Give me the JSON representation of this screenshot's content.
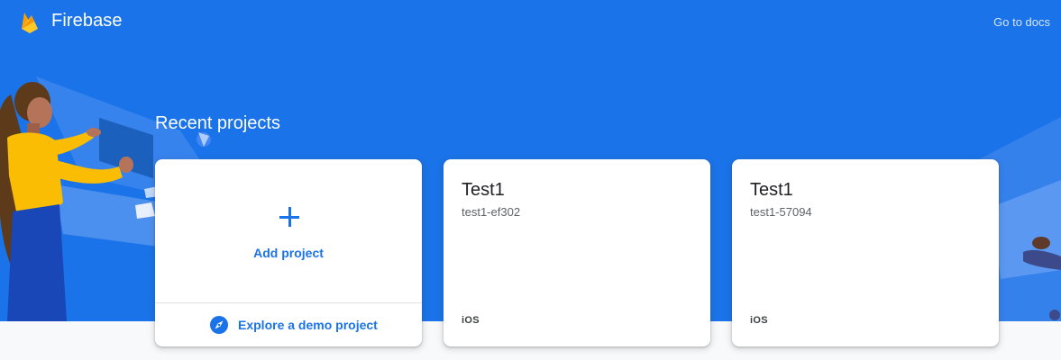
{
  "header": {
    "brand": "Firebase",
    "docs_link": "Go to docs"
  },
  "section": {
    "title": "Recent projects"
  },
  "add_card": {
    "add_label": "Add project",
    "demo_label": "Explore a demo project"
  },
  "projects": [
    {
      "name": "Test1",
      "id": "test1-ef302",
      "platform": "iOS"
    },
    {
      "name": "Test1",
      "id": "test1-57094",
      "platform": "iOS"
    }
  ],
  "colors": {
    "hero": "#1a73e8",
    "accent": "#1a73e8",
    "page_bg": "#f8f9fa",
    "firebase_yellow": "#ffca28",
    "firebase_orange": "#ffa000"
  },
  "icons": {
    "logo": "firebase-flame-icon",
    "add": "plus-icon",
    "demo": "compass-icon"
  }
}
